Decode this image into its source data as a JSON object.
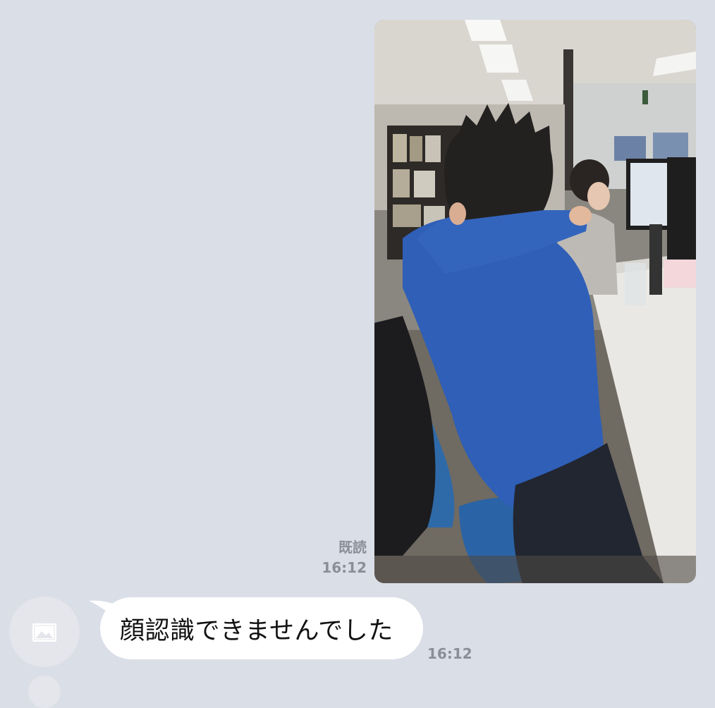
{
  "sent_message": {
    "read_status": "既読",
    "time": "16:12"
  },
  "received_message": {
    "text": "顔認識できませんでした",
    "time": "16:12",
    "avatar_icon": "image-placeholder-icon"
  },
  "colors": {
    "chat_background": "#dadee7",
    "bubble_background": "#ffffff",
    "meta_text": "#8a8e98",
    "avatar_background": "#e4e6ec"
  }
}
